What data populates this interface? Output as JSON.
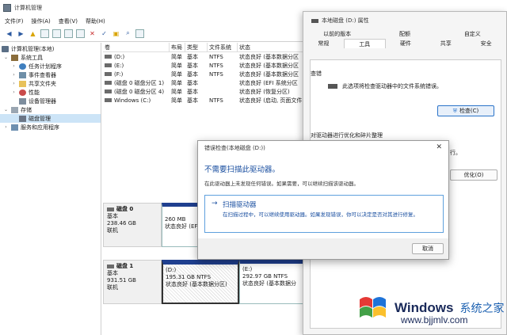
{
  "main_window": {
    "title": "计算机管理",
    "menu": [
      "文件(F)",
      "操作(A)",
      "查看(V)",
      "帮助(H)"
    ]
  },
  "tree": {
    "items": [
      {
        "label": "计算机管理(本地)",
        "indent": 0,
        "icon": "computer-icon"
      },
      {
        "label": "系统工具",
        "indent": 1,
        "icon": "tools-icon"
      },
      {
        "label": "任务计划程序",
        "indent": 2,
        "icon": "clock-icon"
      },
      {
        "label": "事件查看器",
        "indent": 2,
        "icon": "event-log-icon"
      },
      {
        "label": "共享文件夹",
        "indent": 2,
        "icon": "folder-icon"
      },
      {
        "label": "性能",
        "indent": 2,
        "icon": "performance-icon"
      },
      {
        "label": "设备管理器",
        "indent": 2,
        "icon": "device-icon"
      },
      {
        "label": "存储",
        "indent": 1,
        "icon": "storage-icon"
      },
      {
        "label": "磁盘管理",
        "indent": 2,
        "icon": "disk-icon",
        "selected": true
      },
      {
        "label": "服务和应用程序",
        "indent": 1,
        "icon": "services-icon"
      }
    ]
  },
  "volume_list": {
    "headers": [
      "卷",
      "布局",
      "类型",
      "文件系统",
      "状态"
    ],
    "rows": [
      [
        "(D:)",
        "简单",
        "基本",
        "NTFS",
        "状态良好 (基本数据分区"
      ],
      [
        "(E:)",
        "简单",
        "基本",
        "NTFS",
        "状态良好 (基本数据分区"
      ],
      [
        "(F:)",
        "简单",
        "基本",
        "NTFS",
        "状态良好 (基本数据分区"
      ],
      [
        "(磁盘 0 磁盘分区 1)",
        "简单",
        "基本",
        "",
        "状态良好 (EFI 系统分区"
      ],
      [
        "(磁盘 0 磁盘分区 4)",
        "简单",
        "基本",
        "",
        "状态良好 (恢复分区)"
      ],
      [
        "Windows (C:)",
        "简单",
        "基本",
        "NTFS",
        "状态良好 (启动, 页面文件"
      ]
    ]
  },
  "disks": [
    {
      "name": "磁盘 0",
      "type": "基本",
      "size": "238.46 GB",
      "status": "联机",
      "partitions": [
        {
          "size": "260 MB",
          "status": "状态良好 (EFI"
        }
      ]
    },
    {
      "name": "磁盘 1",
      "type": "基本",
      "size": "931.51 GB",
      "status": "联机",
      "partitions": [
        {
          "name": "(D:)",
          "size": "195.31 GB NTFS",
          "status": "状态良好 (基本数据分区)"
        },
        {
          "name": "(E:)",
          "size": "292.97 GB NTFS",
          "status": "状态良好 (基本数据分"
        }
      ]
    }
  ],
  "properties": {
    "title": "本地磁盘 (D:) 属性",
    "tabs_row1": [
      "以前的版本",
      "配额",
      "自定义"
    ],
    "tabs_row2": [
      "常规",
      "工具",
      "硬件",
      "共享",
      "安全"
    ],
    "active_tab": "工具",
    "check_group": "查错",
    "check_desc": "此选项将检查驱动器中的文件系统错误。",
    "check_button": "检查(C)",
    "optimize_group": "对驱动器进行优化和碎片整理",
    "optimize_text_fragment": "行。",
    "optimize_button": "优化(O)"
  },
  "error_dialog": {
    "title": "错误检查(本地磁盘 (D:))",
    "heading": "不需要扫描此驱动器。",
    "description": "在此驱动器上未发现任何错误。如果需要，可以继续扫描该驱动器。",
    "action_title": "扫描驱动器",
    "action_sub": "在扫描过程中，可以继续使用驱动器。如果发现错误，你可以决定是否对其进行修复。",
    "cancel": "取消"
  },
  "watermark": {
    "title": "Windows",
    "subtitle": "系统之家",
    "url": "www.bjjmlv.com",
    "colors": {
      "red": "#e53935",
      "blue": "#1e73d8",
      "green": "#43a047",
      "yellow": "#fbc02d"
    }
  }
}
